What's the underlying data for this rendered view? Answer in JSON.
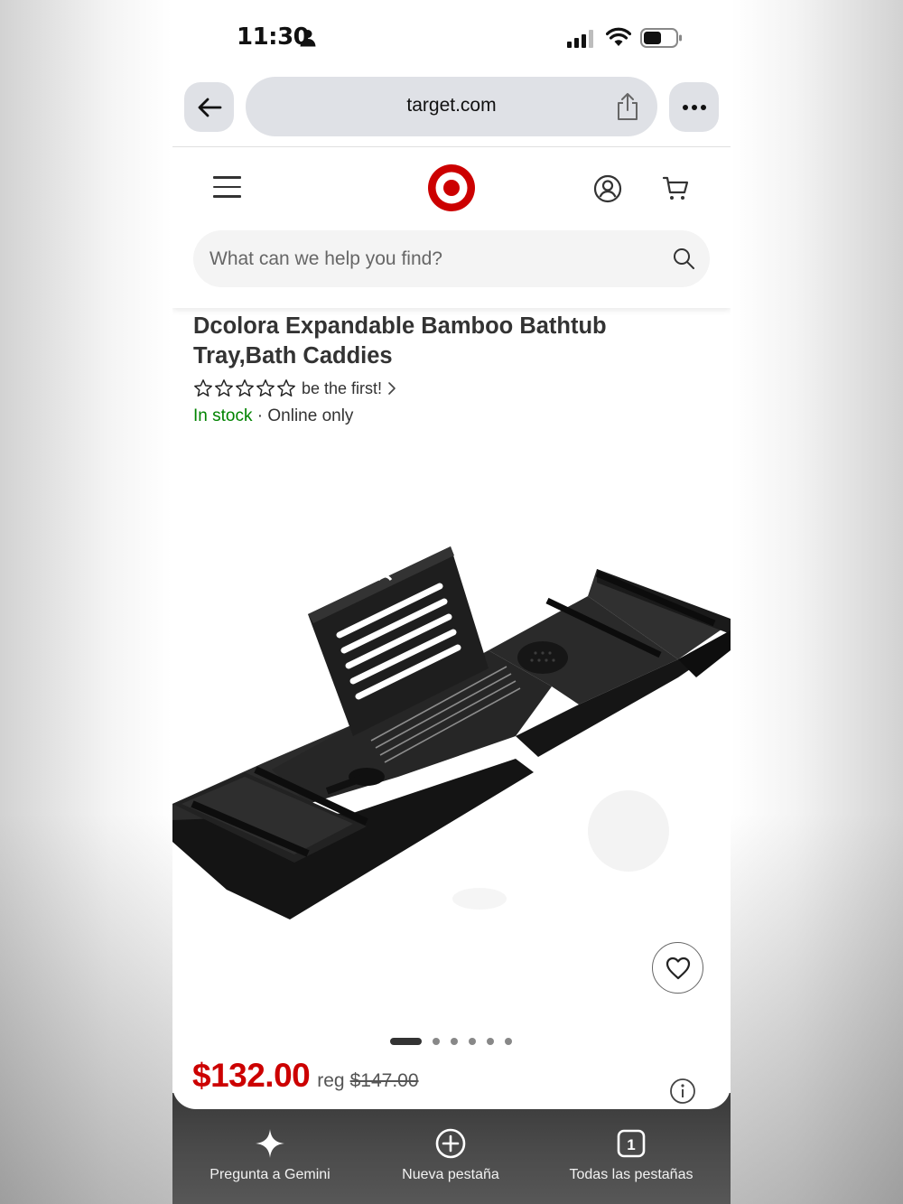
{
  "status_bar": {
    "time": "11:30"
  },
  "browser": {
    "url": "target.com"
  },
  "header": {
    "search_placeholder": "What can we help you find?"
  },
  "product": {
    "title": "Dcolora Expandable Bamboo Bathtub Tray,Bath Caddies",
    "rating": {
      "stars_filled": 0,
      "stars_total": 5,
      "link_text": "be the first!"
    },
    "stock": {
      "status": "In stock",
      "separator": "·",
      "availability": "Online only"
    },
    "carousel": {
      "total": 6,
      "active_index": 0
    },
    "price": {
      "current": "$132.00",
      "reg_label": "reg",
      "reg_price": "$147.00"
    }
  },
  "bottom_bar": {
    "actions": [
      {
        "label": "Pregunta a Gemini",
        "icon": "sparkle-icon"
      },
      {
        "label": "Nueva pestaña",
        "icon": "plus-circle-icon"
      },
      {
        "label": "Todas las pestañas",
        "icon": "tabs-count-icon",
        "count": "1"
      }
    ]
  },
  "colors": {
    "brand_red": "#cc0000",
    "in_stock_green": "#008300",
    "toolbar_gray": "#dfe1e6"
  }
}
